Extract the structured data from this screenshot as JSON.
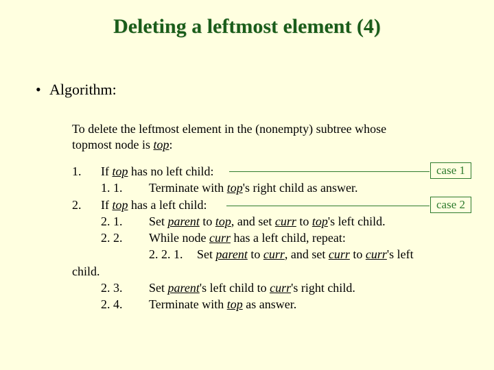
{
  "title": "Deleting a leftmost element (4)",
  "bullet": "Algorithm:",
  "intro_a": "To delete the leftmost element in the (nonempty) subtree whose topmost node is ",
  "intro_top": "top",
  "intro_b": ":",
  "case1": "case 1",
  "case2": "case 2",
  "n1": "1.",
  "l1a": "If ",
  "l1top": "top",
  "l1b": " has no left child:",
  "n11": "1. 1.",
  "l11a": "Terminate with ",
  "l11top": "top",
  "l11b": "'s right child as answer.",
  "n2": "2.",
  "l2a": "If ",
  "l2top": "top",
  "l2b": " has a left child:",
  "n21": "2. 1.",
  "l21a": "Set ",
  "l21parent": "parent",
  "l21b": " to ",
  "l21top": "top",
  "l21c": ", and set ",
  "l21curr": "curr",
  "l21d": " to ",
  "l21top2": "top",
  "l21e": "'s left child.",
  "n22": "2. 2.",
  "l22a": "While node ",
  "l22curr": "curr",
  "l22b": " has a left child, repeat:",
  "n221": "2. 2. 1.",
  "l221a": "Set ",
  "l221parent": "parent",
  "l221b": " to ",
  "l221curr": "curr",
  "l221c": ", and set ",
  "l221curr2": "curr",
  "l221d": " to ",
  "l221curr3": "curr",
  "l221e": "'s left",
  "childword": "child.",
  "n23": "2. 3.",
  "l23a": "Set ",
  "l23parent": "parent",
  "l23b": "'s left child to ",
  "l23curr": "curr",
  "l23c": "'s right child.",
  "n24": "2. 4.",
  "l24a": "Terminate with ",
  "l24top": "top",
  "l24b": " as answer."
}
